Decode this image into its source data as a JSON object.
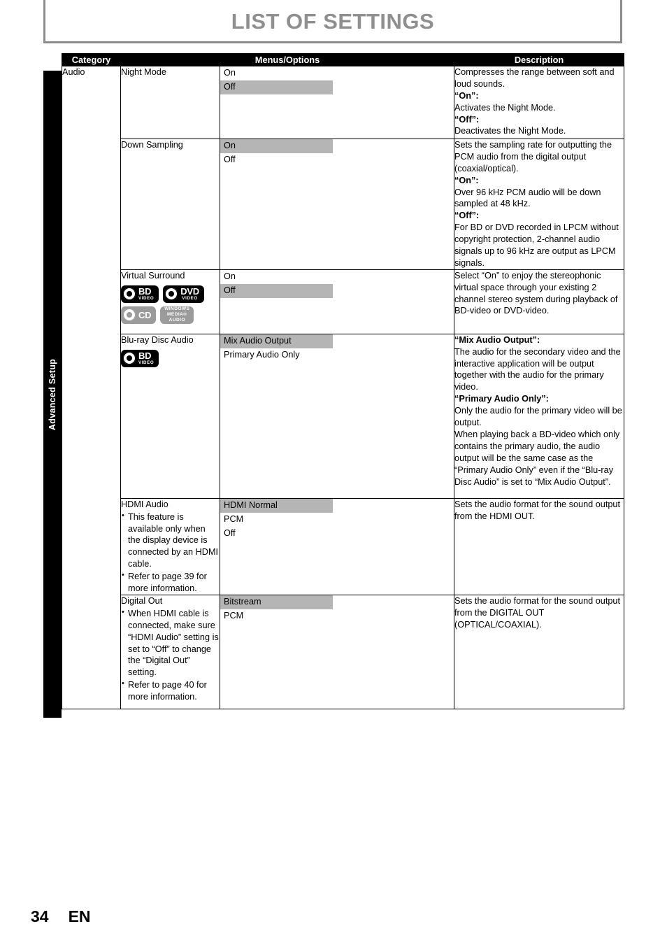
{
  "page": {
    "title": "LIST OF SETTINGS",
    "side_tab_label": "Advanced Setup",
    "footer_page_number": "34",
    "footer_language": "EN",
    "highlight_color": "#b5b5b5",
    "title_color": "#8f8f8f"
  },
  "table": {
    "headers": {
      "category": "Category",
      "menus_options": "Menus/Options",
      "description": "Description"
    },
    "category_label": "Audio",
    "rows": [
      {
        "menu": "Night Mode",
        "notes": [],
        "logos": [],
        "options": [
          {
            "label": "On",
            "selected": false
          },
          {
            "label": "Off",
            "selected": true
          }
        ],
        "description": [
          {
            "text": "Compresses the range between soft and loud sounds.",
            "bold": false
          },
          {
            "text": "“On”:",
            "bold": true
          },
          {
            "text": "Activates the Night Mode.",
            "bold": false
          },
          {
            "text": "“Off”:",
            "bold": true
          },
          {
            "text": "Deactivates the Night Mode.",
            "bold": false
          }
        ]
      },
      {
        "menu": "Down Sampling",
        "notes": [],
        "logos": [],
        "options": [
          {
            "label": "On",
            "selected": true
          },
          {
            "label": "Off",
            "selected": false
          }
        ],
        "description": [
          {
            "text": "Sets the sampling rate for outputting the PCM audio from the digital output (coaxial/optical).",
            "bold": false
          },
          {
            "text": "“On”:",
            "bold": true
          },
          {
            "text": "Over 96 kHz PCM audio will be down sampled at 48 kHz.",
            "bold": false
          },
          {
            "text": "“Off”:",
            "bold": true
          },
          {
            "text": "For BD or DVD recorded in LPCM without copyright protection, 2-channel audio signals up to 96 kHz are output as LPCM signals.",
            "bold": false
          }
        ]
      },
      {
        "menu": "Virtual Surround",
        "notes": [],
        "logos": [
          {
            "name": "bd-video",
            "text": "BD",
            "sub": "VIDEO",
            "style": "dark",
            "kind": "disc"
          },
          {
            "name": "dvd-video",
            "text": "DVD",
            "sub": "VIDEO",
            "style": "dark",
            "kind": "disc"
          },
          {
            "name": "cd",
            "text": "CD",
            "sub": "",
            "style": "grey",
            "kind": "disc"
          },
          {
            "name": "windows-media-audio",
            "text": "WINDOWS\nMEDIA®\nAUDIO",
            "sub": "",
            "style": "grey",
            "kind": "text"
          }
        ],
        "options": [
          {
            "label": "On",
            "selected": false
          },
          {
            "label": "Off",
            "selected": true
          }
        ],
        "description": [
          {
            "text": "Select “On” to enjoy the stereophonic virtual space through your existing 2 channel stereo system during playback of BD-video or DVD-video.",
            "bold": false
          }
        ]
      },
      {
        "menu": "Blu-ray Disc Audio",
        "notes": [],
        "logos": [
          {
            "name": "bd-video",
            "text": "BD",
            "sub": "VIDEO",
            "style": "dark",
            "kind": "disc"
          }
        ],
        "options": [
          {
            "label": "Mix Audio Output",
            "selected": true
          },
          {
            "label": "Primary Audio Only",
            "selected": false
          }
        ],
        "description": [
          {
            "text": "“Mix Audio Output”:",
            "bold": true
          },
          {
            "text": "The audio for the secondary video and the interactive application will be output together with the audio for the primary video.",
            "bold": false
          },
          {
            "text": "“Primary Audio Only”:",
            "bold": true
          },
          {
            "text": "Only the audio for the primary video will be output.",
            "bold": false
          },
          {
            "text": "When playing back a BD-video which only contains the primary audio, the audio output will be the same case as the “Primary Audio Only” even if the “Blu-ray Disc Audio” is set to “Mix Audio Output”.",
            "bold": false
          }
        ]
      },
      {
        "menu": "HDMI Audio",
        "notes": [
          "This feature is available only when the display device is connected by an HDMI cable.",
          "Refer to page 39 for more information."
        ],
        "logos": [],
        "options": [
          {
            "label": "HDMI Normal",
            "selected": true
          },
          {
            "label": "PCM",
            "selected": false
          },
          {
            "label": "Off",
            "selected": false
          }
        ],
        "description": [
          {
            "text": "Sets the audio format for the sound output from the HDMI OUT.",
            "bold": false
          }
        ]
      },
      {
        "menu": "Digital Out",
        "notes": [
          "When HDMI cable is connected, make sure “HDMI Audio” setting is set to “Off” to change the “Digital Out” setting.",
          "Refer to page 40 for more information."
        ],
        "logos": [],
        "options": [
          {
            "label": "Bitstream",
            "selected": true
          },
          {
            "label": "PCM",
            "selected": false
          }
        ],
        "description": [
          {
            "text": "Sets the audio format for the sound output from the DIGITAL OUT (OPTICAL/COAXIAL).",
            "bold": false
          }
        ]
      }
    ]
  }
}
